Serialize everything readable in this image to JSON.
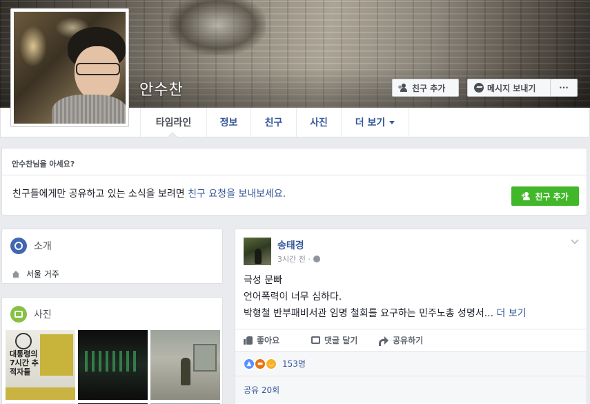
{
  "profile": {
    "name": "안수찬",
    "buttons": {
      "add_friend": "친구 추가",
      "message": "메시지 보내기",
      "more": "···"
    }
  },
  "nav": {
    "tabs": [
      {
        "label": "타임라인",
        "active": true
      },
      {
        "label": "정보"
      },
      {
        "label": "친구"
      },
      {
        "label": "사진"
      },
      {
        "label": "더 보기"
      }
    ]
  },
  "know_card": {
    "title": "안수찬님을 아세요?",
    "text_before": "친구들에게만 공유하고 있는 소식을 보려면 ",
    "link_text": "친구 요청을 보내보세요.",
    "button_label": "친구 추가"
  },
  "intro": {
    "title": "소개",
    "location": "서울 거주"
  },
  "photos": {
    "title": "사진",
    "items": [
      {
        "icon": "poster-photo",
        "text": "대통령의 7시간 추적자들"
      },
      {
        "icon": "night-photo"
      },
      {
        "icon": "guard-photo"
      }
    ]
  },
  "post": {
    "author": "송태경",
    "time": "3시간 전 ·",
    "lines": [
      "극성 문빠",
      "언어폭력이 너무 심하다.",
      "박형철 반부패비서관 임명 철회를 요구하는 민주노총 성명서..."
    ],
    "see_more": "더 보기",
    "actions": {
      "like": "좋아요",
      "comment": "댓글 달기",
      "share": "공유하기"
    },
    "reactions_count": "153명",
    "shares": "공유 20회"
  },
  "colors": {
    "link": "#365899",
    "green_button": "#42b72a",
    "background": "#e9ebee"
  }
}
